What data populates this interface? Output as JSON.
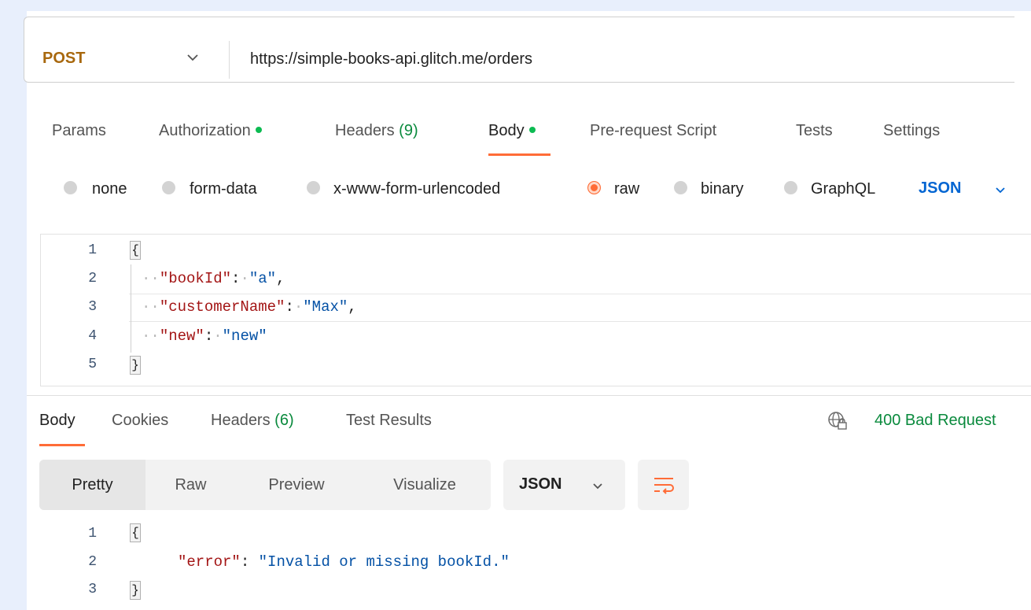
{
  "request": {
    "method": "POST",
    "url": "https://simple-books-api.glitch.me/orders"
  },
  "request_tabs": [
    {
      "label": "Params"
    },
    {
      "label": "Authorization"
    },
    {
      "label": "Headers",
      "count": "(9)"
    },
    {
      "label": "Body"
    },
    {
      "label": "Pre-request Script"
    },
    {
      "label": "Tests"
    },
    {
      "label": "Settings"
    }
  ],
  "body_types": [
    {
      "label": "none"
    },
    {
      "label": "form-data"
    },
    {
      "label": "x-www-form-urlencoded"
    },
    {
      "label": "raw"
    },
    {
      "label": "binary"
    },
    {
      "label": "GraphQL"
    }
  ],
  "body_format": "JSON",
  "request_body": {
    "line_numbers": [
      "1",
      "2",
      "3",
      "4",
      "5"
    ],
    "open_brace": "{",
    "close_brace": "}",
    "fields": [
      {
        "key": "\"bookId\"",
        "value": "\"a\"",
        "comma": ","
      },
      {
        "key": "\"customerName\"",
        "value": "\"Max\"",
        "comma": ","
      },
      {
        "key": "\"new\"",
        "value": "\"new\"",
        "comma": ""
      }
    ]
  },
  "response_tabs": [
    {
      "label": "Body"
    },
    {
      "label": "Cookies"
    },
    {
      "label": "Headers",
      "count": "(6)"
    },
    {
      "label": "Test Results"
    }
  ],
  "response_status": "400 Bad Request",
  "view_modes": [
    "Pretty",
    "Raw",
    "Preview",
    "Visualize"
  ],
  "response_format": "JSON",
  "response_body": {
    "line_numbers": [
      "1",
      "2",
      "3"
    ],
    "open_brace": "{",
    "close_brace": "}",
    "key": "\"error\"",
    "value": "\"Invalid or missing bookId.\""
  },
  "colors": {
    "accent": "#ff6c37",
    "method": "#a8680e",
    "status_ok_dot": "#0cbb52",
    "status_text": "#0a8a3d",
    "link_blue": "#0265d2"
  }
}
